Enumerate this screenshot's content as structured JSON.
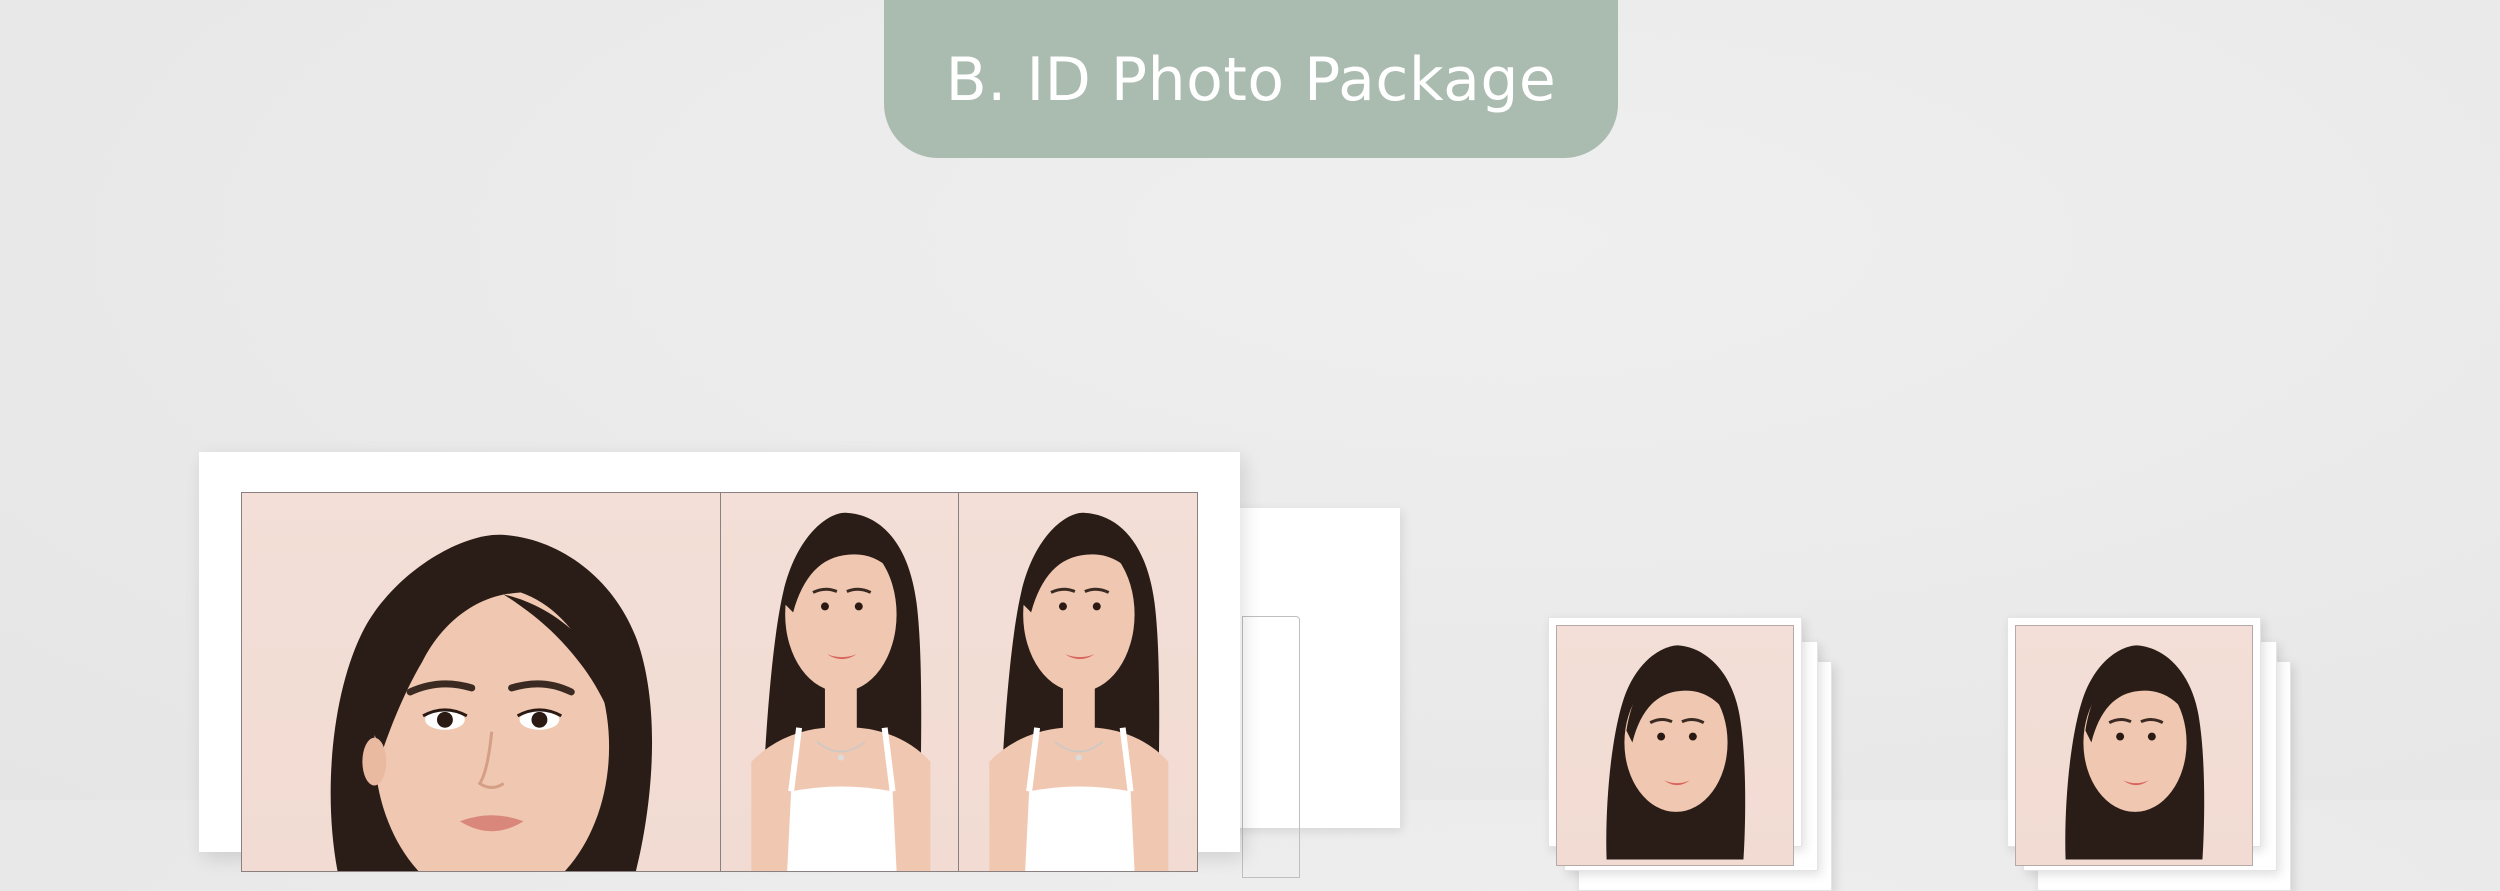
{
  "header": {
    "title": "B. ID Photo Package"
  },
  "colors": {
    "background": "#ebebeb",
    "title_pill": "#aabbb0",
    "title_text": "#ffffff",
    "photo_background": "#f2ddd5",
    "sheet": "#ffffff"
  },
  "print_sheet": {
    "cells": [
      "large-headshot",
      "portrait",
      "portrait"
    ]
  },
  "photo_stacks": [
    {
      "name": "stack-left"
    },
    {
      "name": "stack-right"
    }
  ]
}
